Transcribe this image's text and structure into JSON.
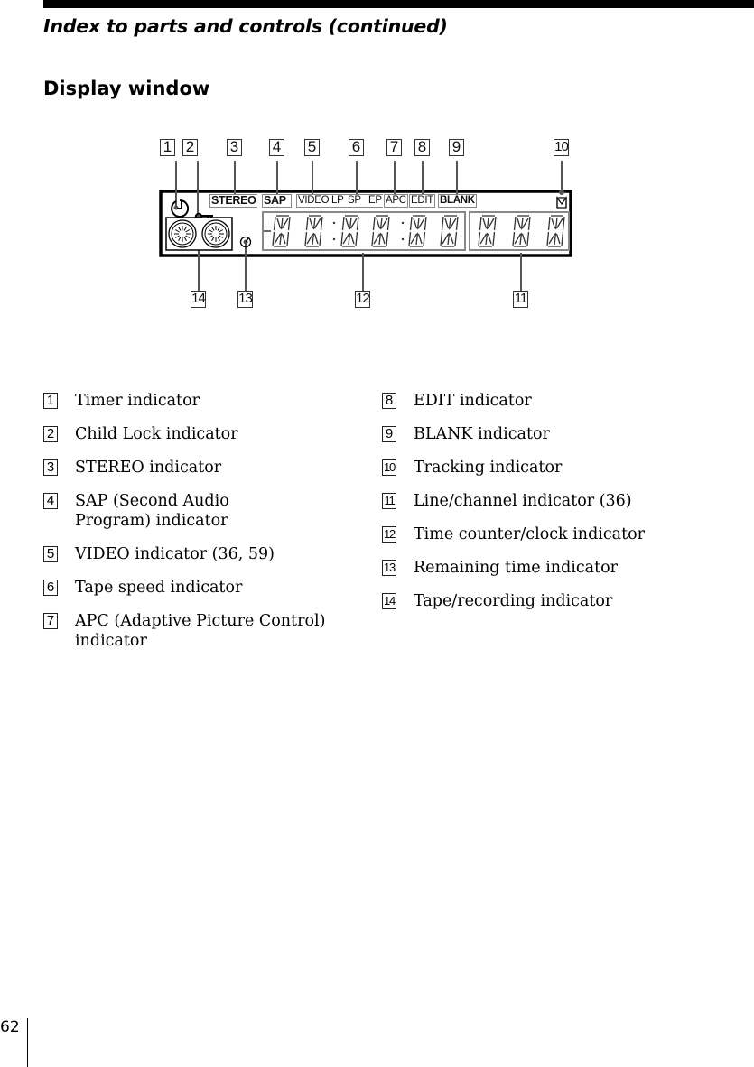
{
  "page": {
    "running_head": "Index to parts and controls (continued)",
    "section_title": "Display window",
    "page_number": "62"
  },
  "diagram": {
    "panel_labels": {
      "stereo": "STEREO",
      "sap": "SAP",
      "video": "VIDEO",
      "lp": "LP",
      "sp": "SP",
      "ep": "EP",
      "apc": "APC",
      "edit": "EDIT",
      "blank": "BLANK"
    },
    "callouts": [
      "1",
      "2",
      "3",
      "4",
      "5",
      "6",
      "7",
      "8",
      "9",
      "10",
      "11",
      "12",
      "13",
      "14"
    ],
    "icons": {
      "timer": "timer-icon",
      "child_lock": "key-icon",
      "tracking": "tracking-icon",
      "remaining_time": "remaining-time-icon",
      "tape_reels": "tape-reels-icon"
    }
  },
  "legend": {
    "left": [
      {
        "num": "1",
        "text": "Timer indicator"
      },
      {
        "num": "2",
        "text": "Child Lock indicator"
      },
      {
        "num": "3",
        "text": "STEREO indicator"
      },
      {
        "num": "4",
        "text": "SAP (Second Audio Program) indicator"
      },
      {
        "num": "5",
        "text": "VIDEO indicator (36, 59)"
      },
      {
        "num": "6",
        "text": "Tape speed indicator"
      },
      {
        "num": "7",
        "text": "APC (Adaptive Picture Control) indicator"
      }
    ],
    "right": [
      {
        "num": "8",
        "text": "EDIT indicator"
      },
      {
        "num": "9",
        "text": "BLANK indicator"
      },
      {
        "num": "10",
        "text": "Tracking indicator"
      },
      {
        "num": "11",
        "text": "Line/channel indicator (36)"
      },
      {
        "num": "12",
        "text": "Time counter/clock indicator"
      },
      {
        "num": "13",
        "text": "Remaining time indicator"
      },
      {
        "num": "14",
        "text": "Tape/recording indicator"
      }
    ]
  }
}
